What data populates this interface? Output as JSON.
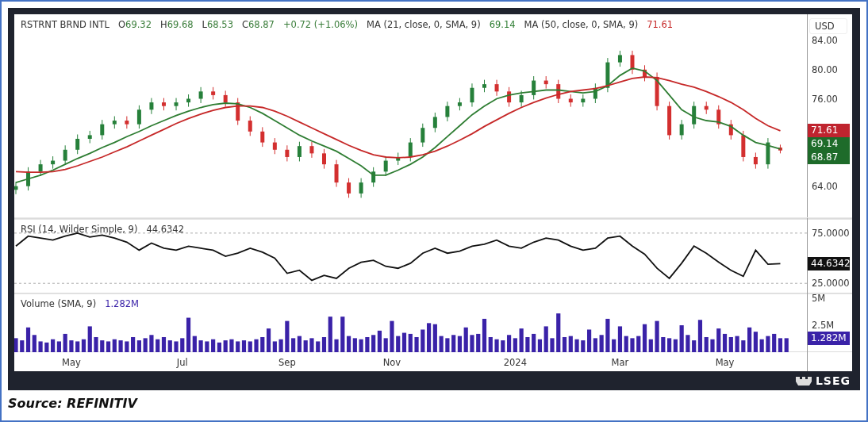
{
  "chart_panel": {
    "currency": "USD",
    "price_pane": {
      "legend": {
        "quotes": [
          {
            "label": "O",
            "value": "69.32"
          },
          {
            "label": "H",
            "value": "69.68"
          },
          {
            "label": "L",
            "value": "68.53"
          },
          {
            "label": "C",
            "value": "68.87"
          }
        ],
        "change": "+0.72 (+1.06%)",
        "indicator_values": [
          "69.14",
          "71.61"
        ]
      },
      "chart_data": {
        "type": "candlestick",
        "title": "RSTRNT BRND INTL",
        "categories": [
          null,
          null,
          null,
          null,
          null,
          null,
          null,
          null,
          null,
          null,
          null,
          null,
          null,
          null,
          null,
          null,
          null,
          null,
          null,
          null,
          null,
          null,
          null,
          null,
          null,
          null,
          null,
          null,
          null,
          null,
          null,
          null,
          null,
          null,
          null,
          null,
          null,
          null,
          null,
          null,
          null,
          null,
          null,
          null,
          null,
          null,
          null,
          null,
          null,
          null,
          null,
          null,
          null,
          null,
          null,
          null,
          null,
          null,
          null,
          null,
          null,
          null,
          null
        ],
        "ylim": [
          59.5,
          87.6
        ],
        "yticks": [
          {
            "value": 64,
            "label": "64.00"
          },
          {
            "value": 76,
            "label": "76.00"
          }
        ],
        "ohlc": [
          [
            63.5,
            64.6,
            62.9,
            64
          ],
          [
            64,
            66.6,
            63.4,
            66
          ],
          [
            66,
            67.6,
            65.4,
            67
          ],
          [
            67,
            68.1,
            66.4,
            67.5
          ],
          [
            67.5,
            69.6,
            66.9,
            69
          ],
          [
            69,
            71.1,
            68.4,
            70.5
          ],
          [
            70.5,
            71.6,
            69.9,
            71
          ],
          [
            71,
            73.1,
            70.4,
            72.5
          ],
          [
            72.5,
            73.6,
            71.9,
            73
          ],
          [
            73,
            73.6,
            71.9,
            72.5
          ],
          [
            72.5,
            75.1,
            71.9,
            74.5
          ],
          [
            74.5,
            76.1,
            73.9,
            75.5
          ],
          [
            75.5,
            76.1,
            74.4,
            75
          ],
          [
            75,
            76.1,
            74.4,
            75.5
          ],
          [
            75.5,
            76.6,
            74.9,
            76
          ],
          [
            76,
            77.6,
            75.4,
            77
          ],
          [
            77,
            77.6,
            75.9,
            76.5
          ],
          [
            76.5,
            77.1,
            74.9,
            75.5
          ],
          [
            75.5,
            76.1,
            72.4,
            73
          ],
          [
            73,
            73.6,
            70.9,
            71.5
          ],
          [
            71.5,
            72.1,
            69.4,
            70
          ],
          [
            70,
            70.6,
            68.4,
            69
          ],
          [
            69,
            69.6,
            67.4,
            68
          ],
          [
            68,
            70.1,
            67.4,
            69.5
          ],
          [
            69.5,
            70.1,
            67.9,
            68.5
          ],
          [
            68.5,
            69.1,
            66.4,
            67
          ],
          [
            67,
            67.6,
            63.9,
            64.5
          ],
          [
            64.5,
            65.1,
            62.4,
            63
          ],
          [
            63,
            65.1,
            62.4,
            64.5
          ],
          [
            64.5,
            66.6,
            63.9,
            66
          ],
          [
            66,
            68.1,
            65.4,
            67.5
          ],
          [
            67.5,
            68.6,
            66.9,
            68
          ],
          [
            68,
            70.6,
            67.4,
            70
          ],
          [
            70,
            72.6,
            69.4,
            72
          ],
          [
            72,
            74.1,
            71.4,
            73.5
          ],
          [
            73.5,
            75.6,
            72.9,
            75
          ],
          [
            75,
            76.1,
            74.4,
            75.5
          ],
          [
            75.5,
            78.1,
            74.9,
            77.5
          ],
          [
            77.5,
            78.6,
            76.9,
            78
          ],
          [
            78,
            78.6,
            76.4,
            77
          ],
          [
            77,
            77.6,
            74.9,
            75.5
          ],
          [
            75.5,
            77.1,
            74.9,
            76.5
          ],
          [
            76.5,
            79.1,
            75.9,
            78.5
          ],
          [
            78.5,
            79.1,
            77.4,
            78
          ],
          [
            78,
            78.6,
            75.4,
            76
          ],
          [
            76,
            76.6,
            74.9,
            75.5
          ],
          [
            75.5,
            76.6,
            74.9,
            76
          ],
          [
            76,
            78.1,
            75.4,
            77.5
          ],
          [
            77.5,
            81.6,
            76.9,
            81
          ],
          [
            81,
            82.6,
            80.4,
            82
          ],
          [
            82,
            82.6,
            79.4,
            80
          ],
          [
            80,
            80.6,
            78.4,
            79
          ],
          [
            79,
            79.6,
            74.4,
            75
          ],
          [
            75,
            75.6,
            70.4,
            71
          ],
          [
            71,
            73.1,
            70.4,
            72.5
          ],
          [
            72.5,
            75.6,
            71.9,
            75
          ],
          [
            75,
            75.6,
            73.9,
            74.5
          ],
          [
            74.5,
            75.1,
            71.9,
            72.5
          ],
          [
            72.5,
            73.1,
            70.4,
            71
          ],
          [
            71,
            71.6,
            67.4,
            68
          ],
          [
            68,
            68.6,
            66.4,
            67
          ],
          [
            67,
            70.6,
            66.4,
            70
          ],
          [
            69.3,
            69.7,
            68.5,
            68.9
          ]
        ]
      },
      "moving_averages": {
        "chart_data": {
          "type": "line",
          "categories": [
            null,
            null,
            null,
            null,
            null,
            null,
            null,
            null,
            null,
            null,
            null,
            null,
            null,
            null,
            null,
            null,
            null,
            null,
            null,
            null,
            null,
            null,
            null,
            null,
            null,
            null,
            null,
            null,
            null,
            null,
            null,
            null,
            null,
            null,
            null,
            null,
            null,
            null,
            null,
            null,
            null,
            null,
            null,
            null,
            null,
            null,
            null,
            null,
            null,
            null,
            null,
            null,
            null,
            null,
            null,
            null,
            null,
            null,
            null,
            null,
            null,
            null,
            null
          ],
          "ylim": [
            59.5,
            87.6
          ],
          "yticks": [
            {
              "value": 80,
              "label": "80.00"
            },
            {
              "value": 84,
              "label": "84.00"
            }
          ],
          "series": [
            {
              "name": "MA (21, close, 0, SMA, 9)",
              "color": "#2e7d32",
              "values": [
                64.5,
                65,
                65.5,
                66.2,
                67,
                67.8,
                68.5,
                69.3,
                70,
                70.8,
                71.5,
                72.3,
                73,
                73.7,
                74.3,
                74.8,
                75.2,
                75.4,
                75.3,
                74.8,
                74,
                73,
                72,
                71,
                70.2,
                69.5,
                68.8,
                67.8,
                66.8,
                65.5,
                65.5,
                66.2,
                67,
                68,
                69.3,
                70.8,
                72.3,
                73.8,
                75,
                76,
                76.5,
                76.8,
                77,
                77.2,
                77.2,
                77,
                76.8,
                77,
                77.8,
                79.2,
                80.2,
                79.8,
                78.5,
                76.5,
                74.5,
                73.5,
                73,
                72.8,
                72.2,
                71,
                70,
                69.6,
                69.1
              ]
            },
            {
              "name": "MA (50, close, 0, SMA, 9)",
              "color": "#c62828",
              "values": [
                66,
                65.9,
                65.9,
                66,
                66.3,
                66.8,
                67.4,
                68,
                68.7,
                69.4,
                70.2,
                71,
                71.8,
                72.6,
                73.3,
                73.9,
                74.4,
                74.8,
                75,
                75,
                74.8,
                74.3,
                73.6,
                72.8,
                72,
                71.2,
                70.4,
                69.6,
                68.9,
                68.3,
                68,
                67.9,
                68,
                68.3,
                68.8,
                69.5,
                70.3,
                71.2,
                72.2,
                73.1,
                74,
                74.8,
                75.5,
                76.1,
                76.6,
                77,
                77.2,
                77.4,
                77.8,
                78.3,
                78.8,
                79,
                78.9,
                78.5,
                78,
                77.6,
                77,
                76.3,
                75.5,
                74.5,
                73.3,
                72.3,
                71.6
              ]
            }
          ]
        }
      },
      "value_tags": [
        {
          "text": "71.61",
          "color": "#c0242f"
        },
        {
          "text": "69.14",
          "color": "#1e6b2a"
        },
        {
          "text": "68.87",
          "color": "#1e6b2a"
        }
      ]
    },
    "rsi_pane": {
      "legend": {
        "value": "44.6342"
      },
      "chart_data": {
        "type": "line",
        "categories": [
          null,
          null,
          null,
          null,
          null,
          null,
          null,
          null,
          null,
          null,
          null,
          null,
          null,
          null,
          null,
          null,
          null,
          null,
          null,
          null,
          null,
          null,
          null,
          null,
          null,
          null,
          null,
          null,
          null,
          null,
          null,
          null,
          null,
          null,
          null,
          null,
          null,
          null,
          null,
          null,
          null,
          null,
          null,
          null,
          null,
          null,
          null,
          null,
          null,
          null,
          null,
          null,
          null,
          null,
          null,
          null,
          null,
          null,
          null,
          null,
          null,
          null,
          null
        ],
        "ylim": [
          14.9,
          89.1
        ],
        "yticks": [
          {
            "value": 75,
            "label": "75.0000"
          },
          {
            "value": 25,
            "label": "25.0000"
          }
        ],
        "series": [
          {
            "name": "RSI (14, Wilder Simple, 9)",
            "color": "#111111",
            "values": [
              62,
              72,
              70,
              68,
              72,
              75,
              71,
              73,
              70,
              66,
              58,
              65,
              60,
              58,
              62,
              60,
              58,
              52,
              55,
              60,
              56,
              50,
              35,
              38,
              28,
              33,
              30,
              40,
              46,
              48,
              42,
              40,
              45,
              55,
              60,
              55,
              57,
              62,
              64,
              68,
              62,
              60,
              66,
              70,
              68,
              62,
              58,
              60,
              70,
              72,
              62,
              54,
              40,
              30,
              45,
              62,
              55,
              46,
              38,
              32,
              58,
              44,
              44.6
            ]
          }
        ]
      },
      "value_tags": [
        {
          "text": "44.6342",
          "color": "#111111"
        }
      ]
    },
    "volume_pane": {
      "legend": {
        "value": "1.282M"
      },
      "chart_data": {
        "type": "bar",
        "categories": [
          null,
          null,
          null,
          null,
          null,
          null,
          null,
          null,
          null,
          "May",
          null,
          null,
          null,
          null,
          null,
          null,
          null,
          null,
          null,
          null,
          null,
          null,
          null,
          null,
          null,
          null,
          null,
          "Jul",
          null,
          null,
          null,
          null,
          null,
          null,
          null,
          null,
          null,
          null,
          null,
          null,
          null,
          null,
          null,
          null,
          "Sep",
          null,
          null,
          null,
          null,
          null,
          null,
          null,
          null,
          null,
          null,
          null,
          null,
          null,
          null,
          null,
          null,
          "Nov",
          null,
          null,
          null,
          null,
          null,
          null,
          null,
          null,
          null,
          null,
          null,
          null,
          null,
          null,
          null,
          null,
          null,
          null,
          null,
          "2024",
          null,
          null,
          null,
          null,
          null,
          null,
          null,
          null,
          null,
          null,
          null,
          null,
          null,
          null,
          null,
          null,
          "Mar",
          null,
          null,
          null,
          null,
          null,
          null,
          null,
          null,
          null,
          null,
          null,
          null,
          null,
          null,
          null,
          null,
          "May",
          null,
          null,
          null,
          null,
          null,
          null,
          null,
          null,
          null,
          null
        ],
        "ylim": [
          0,
          5.45
        ],
        "yticks": [
          {
            "value": 5,
            "label": "5M"
          },
          {
            "value": 2.5,
            "label": "2.5M"
          }
        ],
        "series": [
          {
            "name": "Volume (SMA, 9)",
            "color": "#3a22a8",
            "values": [
              1.3,
              1.1,
              2.3,
              1.6,
              1.0,
              0.9,
              1.2,
              1.0,
              1.7,
              1.1,
              1.0,
              1.2,
              2.4,
              1.4,
              1.1,
              1.0,
              1.2,
              1.1,
              1.0,
              1.4,
              1.1,
              1.3,
              1.6,
              1.2,
              1.4,
              1.1,
              1.0,
              1.3,
              3.2,
              1.5,
              1.1,
              1.0,
              1.2,
              0.9,
              1.1,
              1.2,
              1.0,
              1.1,
              1.0,
              1.2,
              1.4,
              2.2,
              1.0,
              1.2,
              2.9,
              1.3,
              1.5,
              1.1,
              1.3,
              1.0,
              1.4,
              3.3,
              1.2,
              3.3,
              1.5,
              1.3,
              1.2,
              1.4,
              1.6,
              2.0,
              1.3,
              2.9,
              1.5,
              1.8,
              1.7,
              1.4,
              2.1,
              2.7,
              2.6,
              1.5,
              1.3,
              1.6,
              1.5,
              2.3,
              1.6,
              1.7,
              3.1,
              1.4,
              1.2,
              1.1,
              1.6,
              1.3,
              2.2,
              1.4,
              1.7,
              1.2,
              2.4,
              1.3,
              3.6,
              1.4,
              1.5,
              1.2,
              1.1,
              2.1,
              1.3,
              1.6,
              3.1,
              1.2,
              2.4,
              1.5,
              1.3,
              1.5,
              2.6,
              1.2,
              2.9,
              1.4,
              1.3,
              1.2,
              2.5,
              1.6,
              1.1,
              3.0,
              1.4,
              1.2,
              2.2,
              1.7,
              1.4,
              1.5,
              1.1,
              2.3,
              1.9,
              1.2,
              1.5,
              1.7,
              1.3,
              1.3
            ]
          }
        ]
      },
      "value_tags": [
        {
          "text": "1.282M",
          "color": "#3a22a8"
        }
      ]
    },
    "brand": "LSEG"
  },
  "source": "Source: REFINITIV"
}
